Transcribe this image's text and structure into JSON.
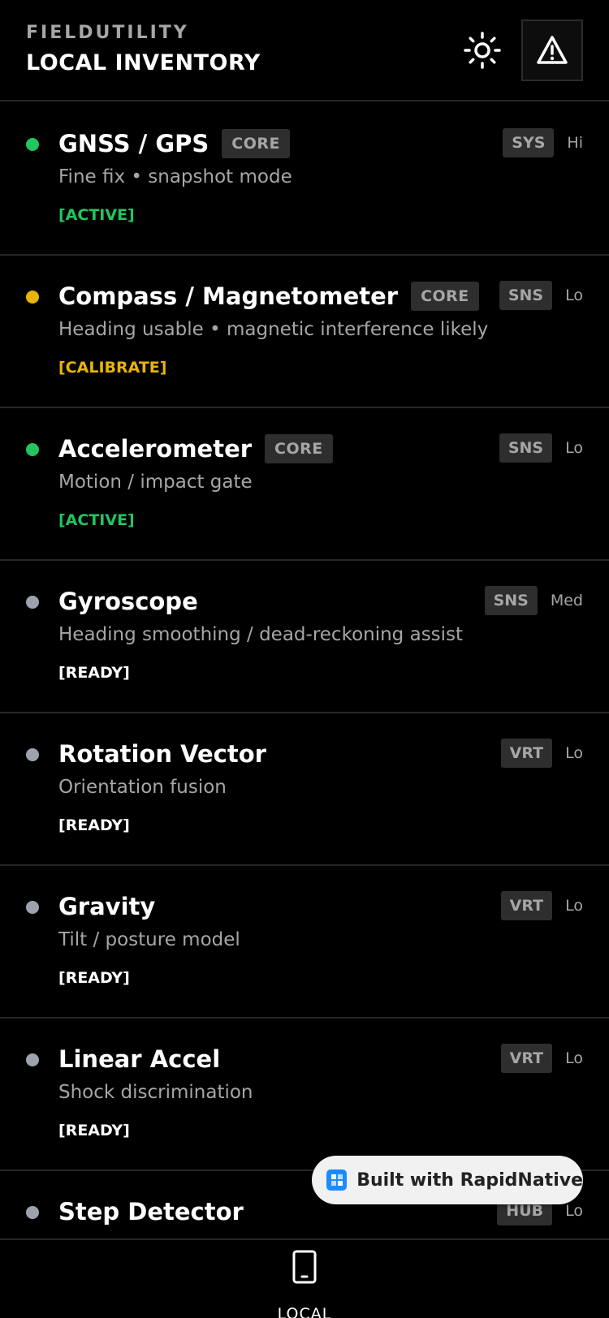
{
  "header": {
    "app_name": "FIELDUTILITY",
    "title": "LOCAL INVENTORY",
    "theme_icon": "sun-icon",
    "alert_icon": "warning-triangle-icon"
  },
  "colors": {
    "active": "#22c55e",
    "calibrate": "#eab308",
    "ready": "#9ca3af"
  },
  "sensors": [
    {
      "name": "GNSS / GPS",
      "core": "CORE",
      "type": "SYS",
      "power": "Hi",
      "desc": "Fine fix • snapshot mode",
      "status": "[ACTIVE]",
      "state": "active"
    },
    {
      "name": "Compass / Magnetometer",
      "core": "CORE",
      "type": "SNS",
      "power": "Lo",
      "desc": "Heading usable • magnetic interference likely",
      "status": "[CALIBRATE]",
      "state": "calibrate"
    },
    {
      "name": "Accelerometer",
      "core": "CORE",
      "type": "SNS",
      "power": "Lo",
      "desc": "Motion / impact gate",
      "status": "[ACTIVE]",
      "state": "active"
    },
    {
      "name": "Gyroscope",
      "type": "SNS",
      "power": "Med",
      "desc": "Heading smoothing / dead-reckoning assist",
      "status": "[READY]",
      "state": "ready"
    },
    {
      "name": "Rotation Vector",
      "type": "VRT",
      "power": "Lo",
      "desc": "Orientation fusion",
      "status": "[READY]",
      "state": "ready"
    },
    {
      "name": "Gravity",
      "type": "VRT",
      "power": "Lo",
      "desc": "Tilt / posture model",
      "status": "[READY]",
      "state": "ready"
    },
    {
      "name": "Linear Accel",
      "type": "VRT",
      "power": "Lo",
      "desc": "Shock discrimination",
      "status": "[READY]",
      "state": "ready"
    },
    {
      "name": "Step Detector",
      "type": "HUB",
      "power": "Lo",
      "state": "ready"
    }
  ],
  "badge": {
    "text": "Built with RapidNative",
    "icon": "rapidnative-logo-icon"
  },
  "bottom_nav": {
    "tab_local_label": "LOCAL",
    "tab_local_icon": "phone-icon"
  }
}
